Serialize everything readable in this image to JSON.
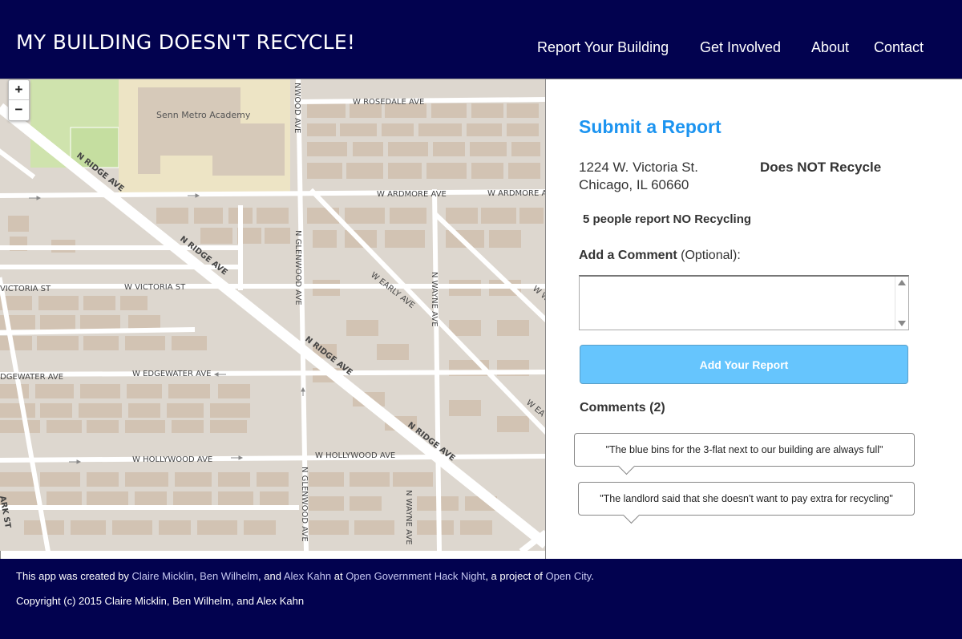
{
  "header": {
    "brand": "MY BUILDING DOESN'T RECYCLE!",
    "nav": [
      "Report Your Building",
      "Get Involved",
      "About",
      "Contact"
    ],
    "background": "#02024f"
  },
  "map": {
    "zoom_in": "+",
    "zoom_out": "−",
    "poi": "Senn Metro Academy",
    "labels": {
      "rosedale": "W ROSEDALE AVE",
      "ardmore": "W ARDMORE AVE",
      "ardmore_right": "W ARDMORE A",
      "victoria_left": "VICTORIA ST",
      "victoria": "W VICTORIA ST",
      "edgewater_left": "DGEWATER AVE",
      "edgewater": "W EDGEWATER AVE",
      "hollywood": "W HOLLYWOOD AVE",
      "hollywood_right": "W HOLLYWOOD AVE",
      "early": "W EARLY AVE",
      "ridge": "N RIDGE AVE",
      "glenwood": "N GLENWOOD AVE",
      "wayne": "N WAYNE AVE",
      "nwood": "NWOOD AVE",
      "ww": "W W",
      "wea": "W EA",
      "ark": "ARK ST"
    }
  },
  "report": {
    "title": "Submit a Report",
    "address_line1": "1224 W. Victoria St.",
    "address_line2": "Chicago, IL 60660",
    "status": "Does NOT Recycle",
    "count_text": "5 people report NO Recycling",
    "comment_label_bold": "Add a Comment",
    "comment_label_rest": " (Optional):",
    "textarea_value": "",
    "submit_label": "Add Your Report",
    "accent": "#1c94f0",
    "button_color": "#66c5fd"
  },
  "comments": {
    "title": "Comments (2)",
    "items": [
      "\"The blue bins for the 3-flat next to our building are always full\"",
      "\"The landlord said  that she doesn't want to pay extra for recycling\""
    ]
  },
  "footer": {
    "created_prefix": "This app was created by ",
    "author1": "Claire Micklin",
    "sep1": ", ",
    "author2": "Ben Wilhelm",
    "sep2": ", and ",
    "author3": "Alex Kahn",
    "at": " at ",
    "event": "Open Government Hack Night",
    "project": ", a project of ",
    "org": "Open City",
    "period": ".",
    "copyright": "Copyright (c) 2015 Claire Micklin, Ben Wilhelm, and Alex Kahn"
  }
}
